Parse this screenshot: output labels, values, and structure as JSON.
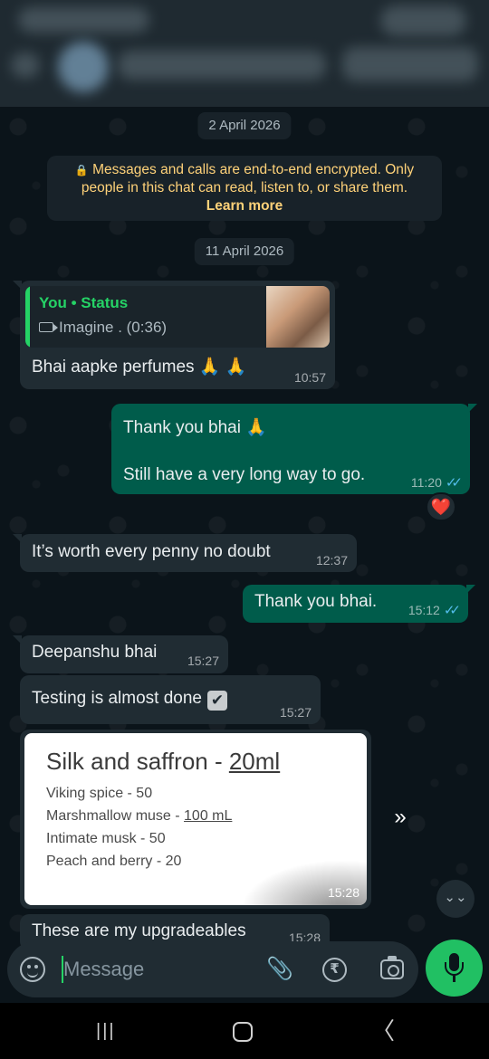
{
  "chat": {
    "dates": [
      "2 April 2026",
      "11 April 2026"
    ],
    "encryption": {
      "lock_icon": "lock-icon",
      "text": "Messages and calls are end-to-end encrypted. Only people in this chat can read, listen to, or share them.",
      "link": "Learn more"
    },
    "messages": [
      {
        "direction": "in",
        "reply": {
          "title": "You • Status",
          "subtitle": "Imagine . (0:36)"
        },
        "text": "Bhai aapke perfumes 🙏 🙏",
        "time": "10:57"
      },
      {
        "direction": "out",
        "line1": "Thank you bhai 🙏",
        "line2": "Still have a very long way to go.",
        "time": "11:20",
        "reaction": "❤️"
      },
      {
        "direction": "in",
        "text": "It’s worth every penny no doubt",
        "time": "12:37"
      },
      {
        "direction": "out",
        "text": "Thank you bhai.",
        "time": "15:12"
      },
      {
        "direction": "in",
        "text": "Deepanshu bhai",
        "time": "15:27"
      },
      {
        "direction": "in",
        "text": "Testing is almost done",
        "check": "✔",
        "time": "15:27"
      },
      {
        "direction": "in",
        "type": "image",
        "image": {
          "title_prefix": "Silk and saffron - ",
          "title_underlined": "20ml",
          "lines": [
            "Viking spice - 50",
            "Marshmallow muse - ",
            "Intimate musk - 50",
            "Peach and berry - 20"
          ],
          "line2_underlined": "100 mL"
        },
        "time": "15:28"
      },
      {
        "direction": "in",
        "text": "These are my upgradeables",
        "time": "15:28"
      }
    ],
    "read_ticks": "✓✓",
    "forward_icon": "»",
    "scroll_down_icon": "⌄⌄"
  },
  "composer": {
    "placeholder": "Message",
    "attach_icon": "paperclip-icon",
    "rupee_symbol": "₹"
  },
  "navbar": {
    "recents": "|||",
    "back": "〈"
  }
}
